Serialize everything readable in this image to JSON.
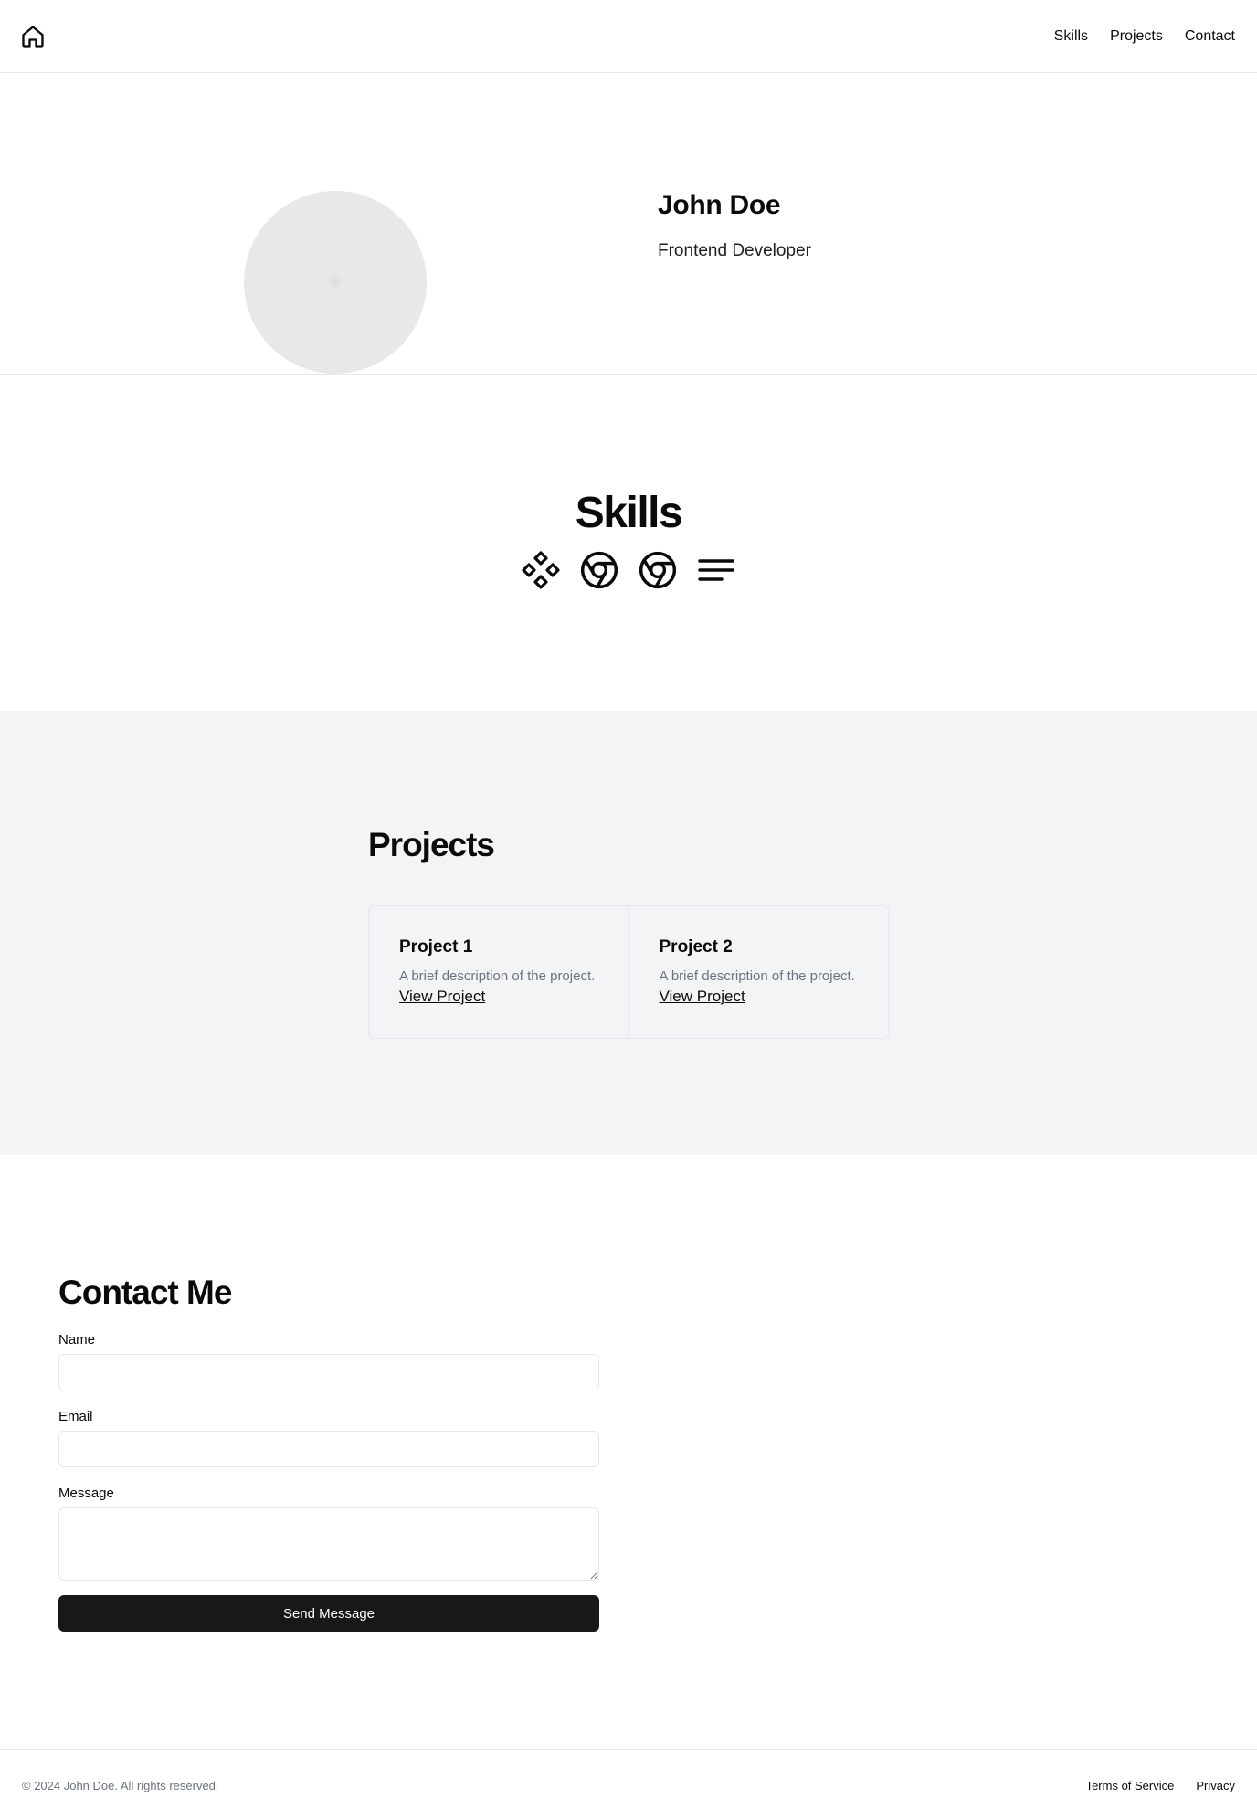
{
  "header": {
    "home_icon": "home-icon",
    "nav": [
      {
        "label": "Skills"
      },
      {
        "label": "Projects"
      },
      {
        "label": "Contact"
      }
    ]
  },
  "hero": {
    "avatar": "avatar-placeholder",
    "name": "John Doe",
    "role": "Frontend Developer"
  },
  "skills": {
    "title": "Skills",
    "icons": [
      "diamonds-icon",
      "chrome-icon",
      "chrome-icon",
      "align-left-icon"
    ]
  },
  "projects": {
    "title": "Projects",
    "items": [
      {
        "name": "Project 1",
        "description": "A brief description of the project.",
        "link": "View Project"
      },
      {
        "name": "Project 2",
        "description": "A brief description of the project.",
        "link": "View Project"
      }
    ]
  },
  "contact": {
    "title": "Contact Me",
    "name_label": "Name",
    "name_value": "",
    "email_label": "Email",
    "email_value": "",
    "message_label": "Message",
    "message_value": "",
    "submit_label": "Send Message"
  },
  "footer": {
    "copyright": "© 2024 John Doe. All rights reserved.",
    "links": [
      {
        "label": "Terms of Service"
      },
      {
        "label": "Privacy"
      }
    ]
  },
  "colors": {
    "text": "#0a0a0a",
    "muted": "#6b7280",
    "border": "#e5e7eb",
    "section_bg": "#f3f4f6",
    "button_bg": "#18181b",
    "avatar_bg": "#e8e8e8"
  }
}
